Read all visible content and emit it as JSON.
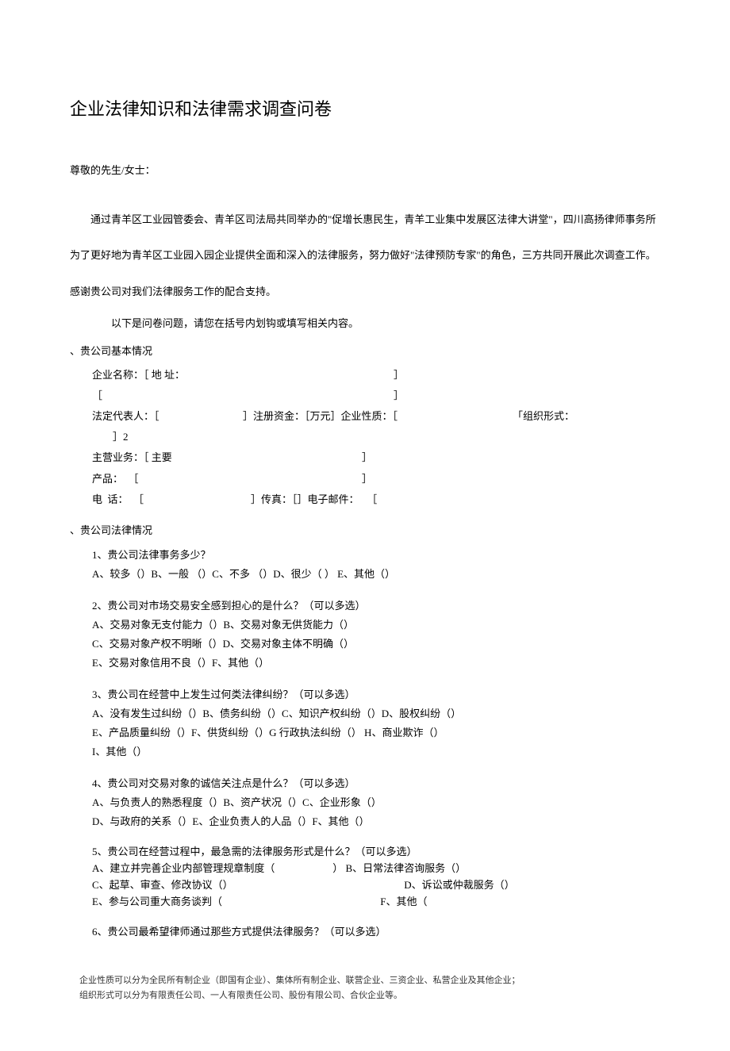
{
  "title": "企业法律知识和法律需求调查问卷",
  "salutation": "尊敬的先生/女士：",
  "intro": "通过青羊区工业园管委会、青羊区司法局共同举办的\"促增长惠民生，青羊工业集中发展区法律大讲堂\"，四川高扬律师事务所为了更好地为青羊区工业园入园企业提供全面和深入的法律服务，努力做好\"法律预防专家\"的角色，三方共同开展此次调查工作。感谢贵公司对我们法律服务工作的配合支持。",
  "instruction": "以下是问卷问题，请您在括号内划钩或填写相关内容。",
  "section1": {
    "header": "、贵公司基本情况",
    "rows": {
      "r1a": "企业名称：［ 地 址：",
      "r1b": "］",
      "r2a": "［",
      "r2b": "］",
      "r3a": "法定代表人：［",
      "r3b": "］注册资金：［万元］企业性质：［",
      "r3c": "「组织形式：",
      "r3d": "］2",
      "r4a": "主营业务：［ 主要",
      "r4b": "］",
      "r5a": "产品：  ［",
      "r5b": "］",
      "r6a": "电  话：  ［",
      "r6b": "］传真：［］电子邮件：   ［"
    }
  },
  "section2": {
    "header": "、贵公司法律情况",
    "q1": {
      "text": "1、贵公司法律事务多少？",
      "opts": "A、较多（）B、一般  （）C、不多  （）D、很少（                              ） E、其他（）"
    },
    "q2": {
      "text": "2、贵公司对市场交易安全感到担心的是什么？（可以多选）",
      "l1": "A、交易对象无支付能力（）B、交易对象无供货能力（）",
      "l2": "C、交易对象产权不明晰（）D、交易对象主体不明确（）",
      "l3": "E、交易对象信用不良（）F、其他（）"
    },
    "q3": {
      "text": "3、贵公司在经营中上发生过何类法律纠纷？（可以多选）",
      "l1": "A、没有发生过纠纷（）B、债务纠纷（）C、知识产权纠纷（）D、股权纠纷（）",
      "l2": "E、产品质量纠纷（）F、供货纠纷（）G 行政执法纠纷（） H、商业欺诈（）",
      "l3": "I、其他（）"
    },
    "q4": {
      "text": "4、贵公司对交易对象的诚信关注点是什么？（可以多选）",
      "l1": "A、与负责人的熟悉程度（）B、资产状况（）C、企业形象（）",
      "l2": "D、与政府的关系（）E、企业负责人的人品（）F、其他（）"
    },
    "q5": {
      "text": "5、贵公司在经营过程中，最急需的法律服务形式是什么？（可以多选）",
      "l1a": "A、建立并完善企业内部管理规章制度（",
      "l1b": "）  B、日常法律咨询服务（）",
      "l2a": "C、起草、审查、修改协议（）",
      "l2b": "D、诉讼或仲裁服务（）",
      "l3a": "E、参与公司重大商务谈判（",
      "l3b": "F、其他（"
    },
    "q6": {
      "text": "6、贵公司最希望律师通过那些方式提供法律服务？（可以多选）"
    }
  },
  "footnote": {
    "l1": "企业性质可以分为全民所有制企业（即国有企业）、集体所有制企业、联营企业、三资企业、私营企业及其他企业；",
    "l2": "组织形式可以分为有限责任公司、一人有限责任公司、股份有限公司、合伙企业等。"
  }
}
